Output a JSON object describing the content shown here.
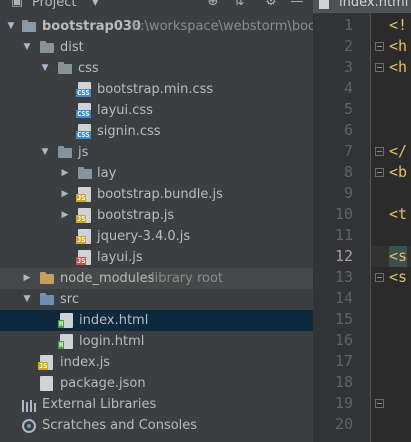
{
  "panel": {
    "title": "Project",
    "tree": [
      {
        "label": "bootstrap030",
        "path": "E:\\workspace\\webstorm\\bootst",
        "type": "root"
      },
      {
        "label": "dist",
        "type": "folder"
      },
      {
        "label": "css",
        "type": "folder"
      },
      {
        "label": "bootstrap.min.css",
        "type": "css"
      },
      {
        "label": "layui.css",
        "type": "css"
      },
      {
        "label": "signin.css",
        "type": "css"
      },
      {
        "label": "js",
        "type": "folder"
      },
      {
        "label": "lay",
        "type": "folder"
      },
      {
        "label": "bootstrap.bundle.js",
        "type": "js"
      },
      {
        "label": "bootstrap.js",
        "type": "js"
      },
      {
        "label": "jquery-3.4.0.js",
        "type": "js"
      },
      {
        "label": "layui.js",
        "type": "js"
      },
      {
        "label": "node_modules",
        "suffix": "library root",
        "type": "lib"
      },
      {
        "label": "src",
        "type": "folder"
      },
      {
        "label": "index.html",
        "type": "html"
      },
      {
        "label": "login.html",
        "type": "html"
      },
      {
        "label": "index.js",
        "type": "js"
      },
      {
        "label": "package.json",
        "type": "json"
      },
      {
        "label": "External Libraries",
        "type": "extlib"
      },
      {
        "label": "Scratches and Consoles",
        "type": "scratch"
      }
    ]
  },
  "editor": {
    "tab": "index.html",
    "current_line": 12,
    "lines": [
      {
        "n": "1",
        "code": "<!"
      },
      {
        "n": "2",
        "code": "<h"
      },
      {
        "n": "3",
        "code": "<h"
      },
      {
        "n": "4",
        "code": ""
      },
      {
        "n": "5",
        "code": ""
      },
      {
        "n": "6",
        "code": ""
      },
      {
        "n": "7",
        "code": "</"
      },
      {
        "n": "8",
        "code": "<b"
      },
      {
        "n": "9",
        "code": ""
      },
      {
        "n": "10",
        "code": "<t"
      },
      {
        "n": "11",
        "code": ""
      },
      {
        "n": "12",
        "code": "<s"
      },
      {
        "n": "13",
        "code": "<s"
      },
      {
        "n": "14",
        "code": ""
      },
      {
        "n": "15",
        "code": ""
      },
      {
        "n": "16",
        "code": ""
      },
      {
        "n": "17",
        "code": ""
      },
      {
        "n": "18",
        "code": ""
      },
      {
        "n": "19",
        "code": ""
      },
      {
        "n": "20",
        "code": ""
      }
    ]
  },
  "colors": {
    "css_badge": "#3d8bd4",
    "js_badge": "#d0a62c",
    "html_badge": "#4e9a3b"
  }
}
